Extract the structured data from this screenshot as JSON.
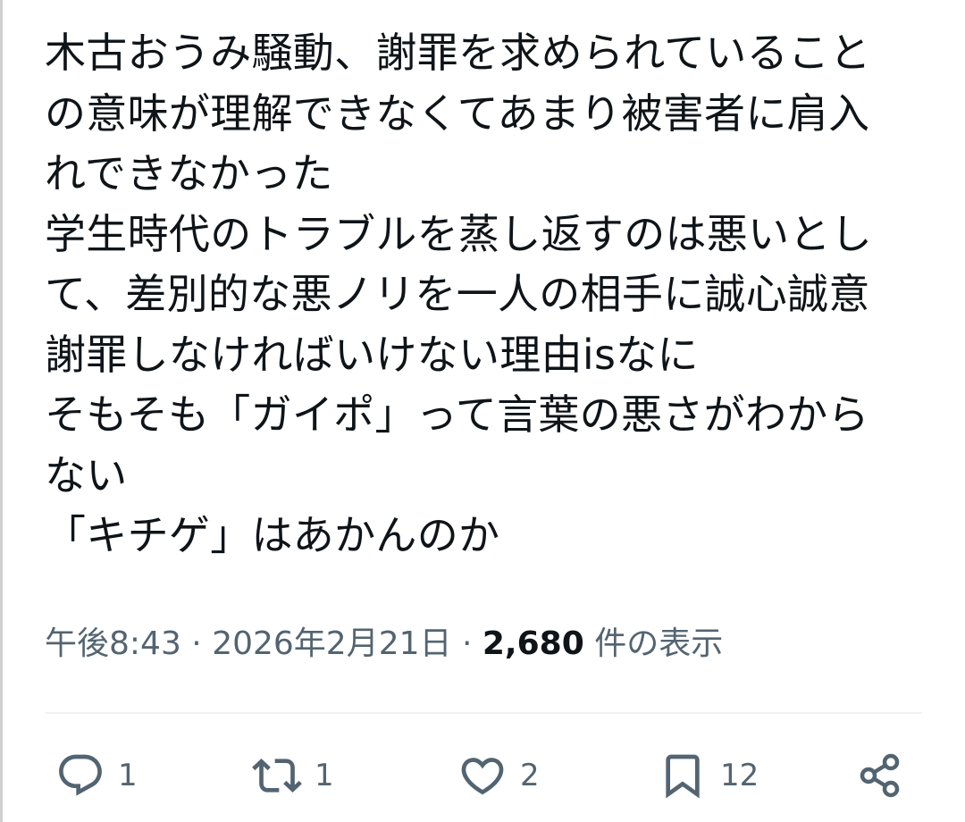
{
  "tweet": {
    "lines": [
      "木古おうみ騒動、謝罪を求められていること",
      "の意味が理解できなくてあまり被害者に肩入",
      "れできなかった",
      "学生時代のトラブルを蒸し返すのは悪いとし",
      "て、差別的な悪ノリを一人の相手に誠心誠意",
      "謝罪しなければいけない理由isなに",
      "そもそも「ガイポ」って言葉の悪さがわから",
      "ない",
      "「キチゲ」はあかんのか"
    ]
  },
  "meta": {
    "time": "午後8:43",
    "separator": " · ",
    "date": "2026年2月21日",
    "views_count": "2,680",
    "views_label": " 件の表示"
  },
  "actions": {
    "reply_count": "1",
    "repost_count": "1",
    "like_count": "2",
    "bookmark_count": "12"
  },
  "colors": {
    "text": "#0f1419",
    "secondary": "#536471",
    "divider": "#eff3f4"
  },
  "icons": {
    "reply": "reply-icon",
    "repost": "repost-icon",
    "like": "heart-icon",
    "bookmark": "bookmark-icon",
    "share": "share-icon"
  }
}
